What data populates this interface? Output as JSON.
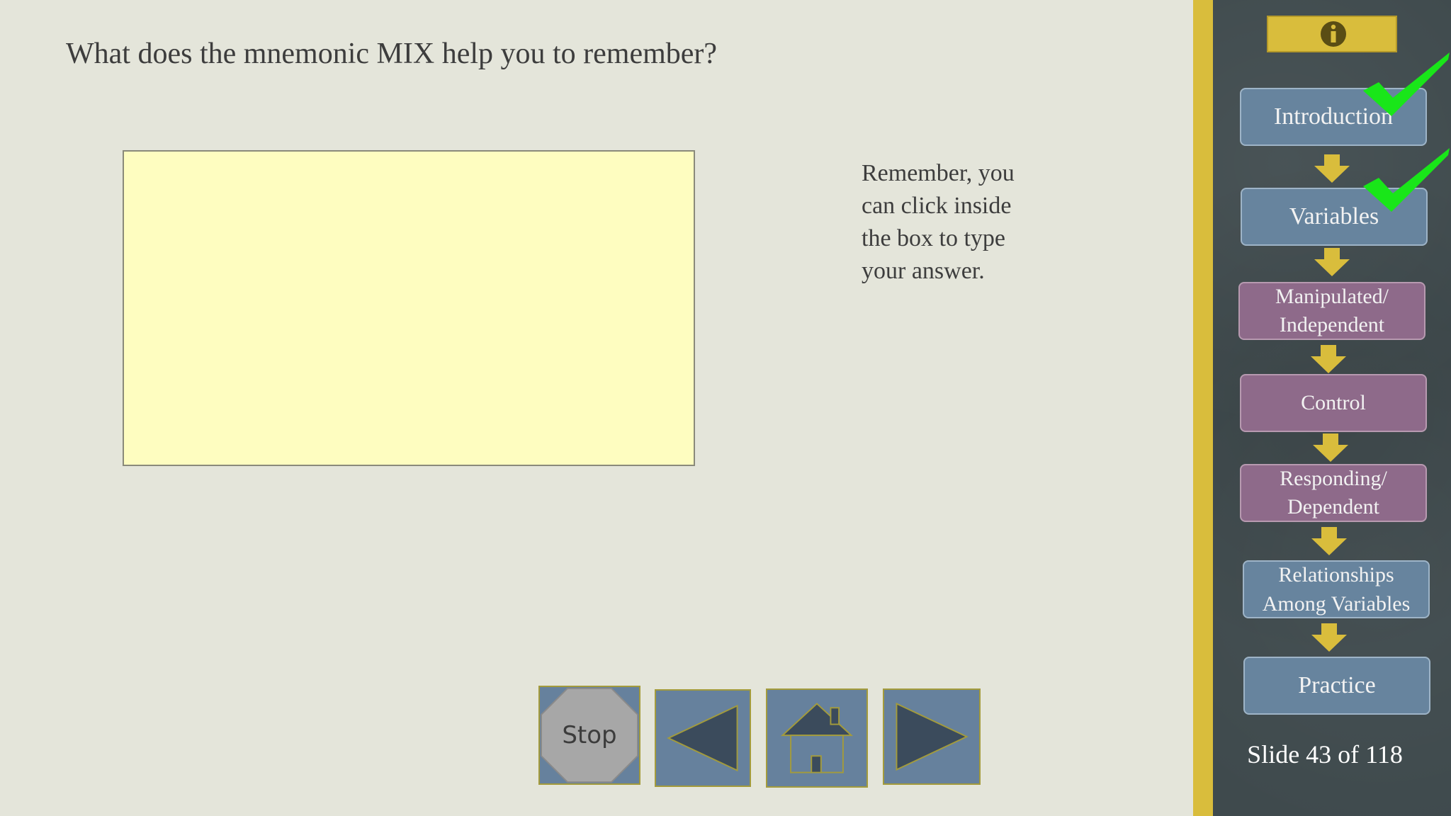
{
  "question": "What does the mnemonic MIX help you to remember?",
  "answer": {
    "value": "",
    "placeholder": ""
  },
  "hint": "Remember, you can click inside the box to type your answer.",
  "controls": {
    "stop_label": "Stop"
  },
  "sidebar": {
    "steps": [
      {
        "label": "Introduction",
        "color": "blue",
        "completed": true
      },
      {
        "label": "Variables",
        "color": "blue",
        "completed": true
      },
      {
        "label": "Manipulated/ Independent",
        "color": "purple",
        "completed": false
      },
      {
        "label": "Control",
        "color": "purple",
        "completed": false
      },
      {
        "label": "Responding/ Dependent",
        "color": "purple",
        "completed": false
      },
      {
        "label": "Relationships Among Variables",
        "color": "blue",
        "completed": false
      },
      {
        "label": "Practice",
        "color": "blue",
        "completed": false
      }
    ],
    "slide_counter": "Slide 43 of 118"
  },
  "icons": [
    "info-icon",
    "stop-sign-icon",
    "back-arrow-icon",
    "home-icon",
    "forward-arrow-icon",
    "down-arrow-icon",
    "checkmark-icon"
  ],
  "colors": {
    "accent_gold": "#d9bd3c",
    "button_blue": "#66819d",
    "step_purple": "#8e6a8a",
    "answer_box": "#fefdc0",
    "check_green": "#19e619"
  }
}
